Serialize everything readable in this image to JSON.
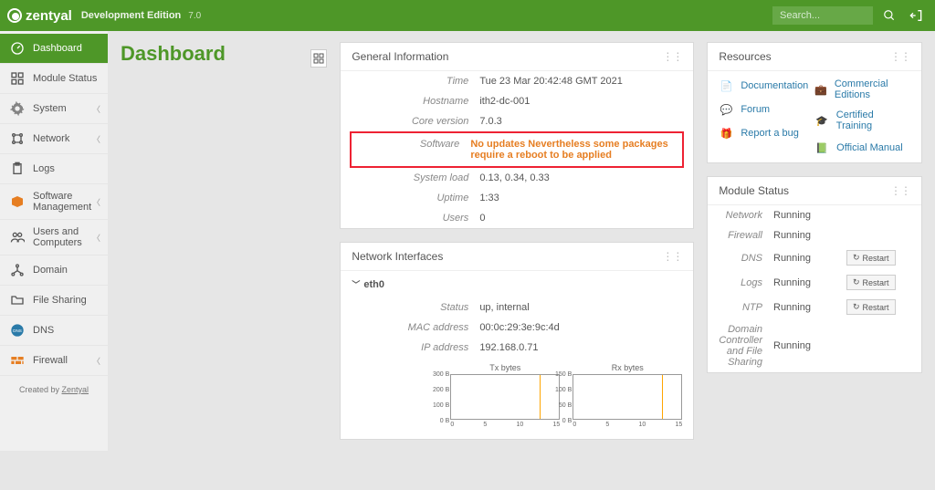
{
  "brand": {
    "name": "zentyal",
    "edition": "Development Edition",
    "version": "7.0"
  },
  "search": {
    "placeholder": "Search..."
  },
  "page": {
    "title": "Dashboard"
  },
  "nav": {
    "items": [
      {
        "label": "Dashboard",
        "active": true,
        "icon": "gauge",
        "chev": false
      },
      {
        "label": "Module Status",
        "active": false,
        "icon": "grid",
        "chev": false
      },
      {
        "label": "System",
        "active": false,
        "icon": "gear",
        "chev": true
      },
      {
        "label": "Network",
        "active": false,
        "icon": "net",
        "chev": true
      },
      {
        "label": "Logs",
        "active": false,
        "icon": "clipboard",
        "chev": false
      },
      {
        "label": "Software Management",
        "active": false,
        "icon": "box",
        "chev": true
      },
      {
        "label": "Users and Computers",
        "active": false,
        "icon": "users",
        "chev": true
      },
      {
        "label": "Domain",
        "active": false,
        "icon": "domain",
        "chev": false
      },
      {
        "label": "File Sharing",
        "active": false,
        "icon": "folder",
        "chev": false
      },
      {
        "label": "DNS",
        "active": false,
        "icon": "dns",
        "chev": false
      },
      {
        "label": "Firewall",
        "active": false,
        "icon": "wall",
        "chev": true
      }
    ],
    "credit_prefix": "Created by ",
    "credit_link": "Zentyal"
  },
  "general": {
    "title": "General Information",
    "rows": {
      "time": {
        "k": "Time",
        "v": "Tue 23 Mar 20:42:48 GMT 2021"
      },
      "host": {
        "k": "Hostname",
        "v": "ith2-dc-001"
      },
      "core": {
        "k": "Core version",
        "v": "7.0.3"
      },
      "soft": {
        "k": "Software",
        "v": "No updates Nevertheless some packages require a reboot to be applied"
      },
      "load": {
        "k": "System load",
        "v": "0.13, 0.34, 0.33"
      },
      "uptime": {
        "k": "Uptime",
        "v": "1:33"
      },
      "users": {
        "k": "Users",
        "v": "0"
      }
    }
  },
  "netif": {
    "title": "Network Interfaces",
    "iface": "eth0",
    "rows": {
      "status": {
        "k": "Status",
        "v": "up, internal"
      },
      "mac": {
        "k": "MAC address",
        "v": "00:0c:29:3e:9c:4d"
      },
      "ip": {
        "k": "IP address",
        "v": "192.168.0.71"
      }
    },
    "tx_title": "Tx bytes",
    "rx_title": "Rx bytes"
  },
  "resources": {
    "title": "Resources",
    "left": [
      {
        "label": "Documentation",
        "icon": "doc",
        "color": "#2a7aa8"
      },
      {
        "label": "Forum",
        "icon": "chat",
        "color": "#e67e22"
      },
      {
        "label": "Report a bug",
        "icon": "bug",
        "color": "#c0392b"
      }
    ],
    "right": [
      {
        "label": "Commercial Editions",
        "icon": "briefcase",
        "color": "#333"
      },
      {
        "label": "Certified Training",
        "icon": "grad",
        "color": "#e67e22"
      },
      {
        "label": "Official Manual",
        "icon": "book",
        "color": "#27ae60"
      }
    ]
  },
  "modstatus": {
    "title": "Module Status",
    "rows": [
      {
        "k": "Network",
        "v": "Running",
        "restart": false
      },
      {
        "k": "Firewall",
        "v": "Running",
        "restart": false
      },
      {
        "k": "DNS",
        "v": "Running",
        "restart": true
      },
      {
        "k": "Logs",
        "v": "Running",
        "restart": true
      },
      {
        "k": "NTP",
        "v": "Running",
        "restart": true
      },
      {
        "k": "Domain Controller and File Sharing",
        "v": "Running",
        "restart": false
      }
    ],
    "restart_label": "Restart"
  },
  "chart_data": [
    {
      "type": "line",
      "title": "Tx bytes",
      "x": [
        0,
        5,
        10,
        15
      ],
      "y_ticks": [
        "0 B",
        "100 B",
        "200 B",
        "300 B"
      ],
      "ylim": [
        0,
        300
      ],
      "series": [
        {
          "name": "tx",
          "values": [
            0,
            0,
            0,
            300
          ]
        }
      ]
    },
    {
      "type": "line",
      "title": "Rx bytes",
      "x": [
        0,
        5,
        10,
        15
      ],
      "y_ticks": [
        "0 B",
        "50 B",
        "100 B",
        "150 B"
      ],
      "ylim": [
        0,
        150
      ],
      "series": [
        {
          "name": "rx",
          "values": [
            0,
            0,
            0,
            150
          ]
        }
      ]
    }
  ]
}
